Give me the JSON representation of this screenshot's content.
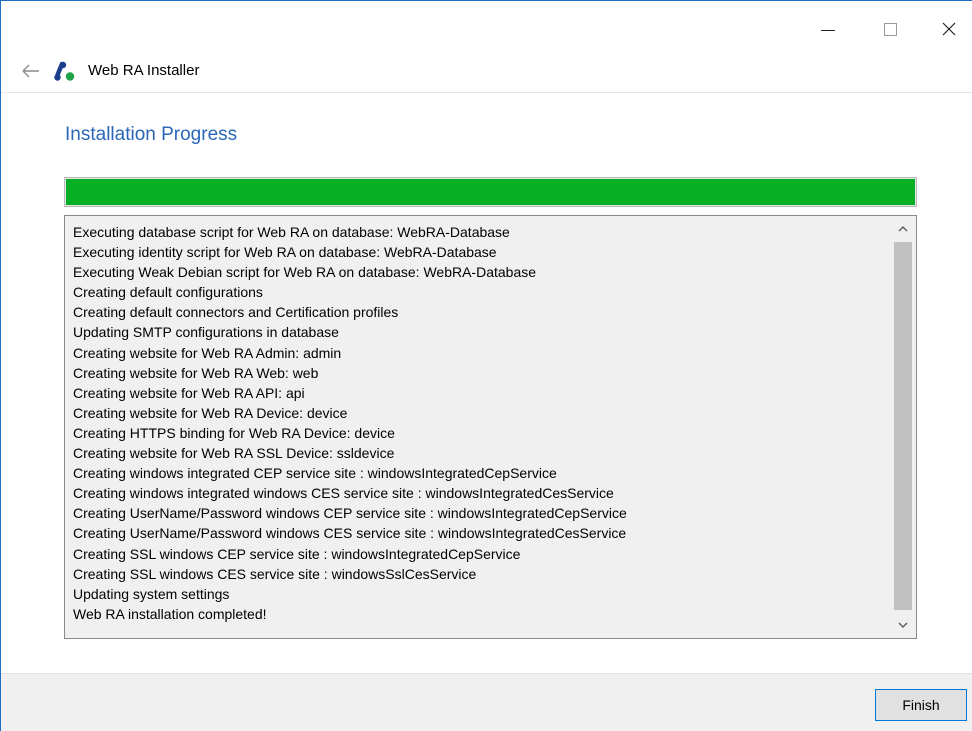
{
  "window": {
    "title": "Web RA Installer",
    "controls": {
      "minimize": "minimize-icon",
      "maximize": "maximize-icon",
      "close": "close-icon",
      "back": "back-arrow-icon"
    }
  },
  "page": {
    "title": "Installation Progress"
  },
  "progress": {
    "fraction": 1.0,
    "color": "#06b025"
  },
  "log": {
    "lines": [
      "Executing database script for Web RA on database: WebRA-Database",
      "Executing identity script for Web RA on database: WebRA-Database",
      "Executing Weak Debian script for Web RA on database: WebRA-Database",
      "Creating default configurations",
      "Creating default connectors and Certification profiles",
      "Updating SMTP configurations in database",
      "Creating website for Web RA Admin: admin",
      "Creating website for Web RA Web: web",
      "Creating website for Web RA API: api",
      "Creating website for Web RA Device: device",
      "Creating HTTPS binding for Web RA Device: device",
      "Creating website for Web RA SSL Device: ssldevice",
      "Creating windows integrated CEP service site : windowsIntegratedCepService",
      "Creating windows integrated windows CES service site :  windowsIntegratedCesService",
      "Creating UserName/Password windows CEP service site : windowsIntegratedCepService",
      "Creating UserName/Password windows CES service site : windowsIntegratedCesService",
      "Creating SSL windows CEP service site : windowsIntegratedCepService",
      "Creating SSL windows CES service site : windowsSslCesService",
      "Updating system settings",
      "Web RA installation completed!"
    ]
  },
  "footer": {
    "finish_label": "Finish"
  },
  "colors": {
    "accent": "#2b66b8",
    "progress": "#06b025",
    "button_border": "#0078d7"
  }
}
